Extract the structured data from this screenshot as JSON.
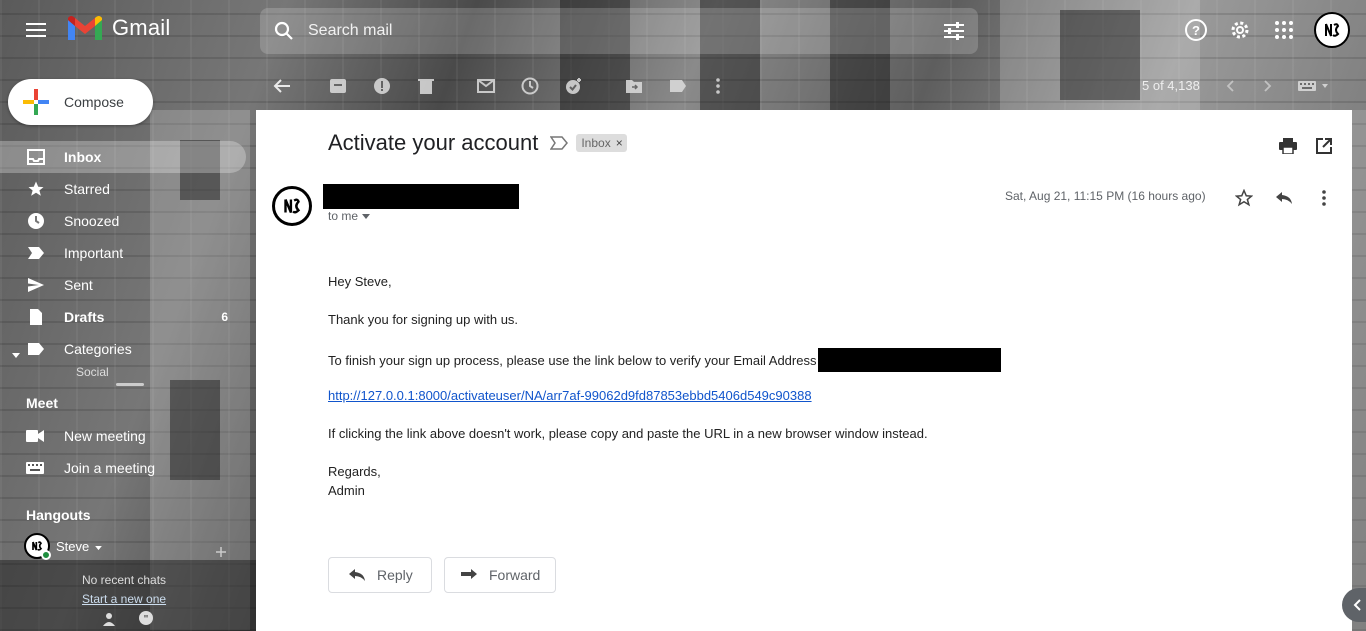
{
  "app": {
    "logo_text": "Gmail"
  },
  "search": {
    "placeholder": "Search mail"
  },
  "compose": {
    "label": "Compose"
  },
  "sidebar": {
    "items": [
      {
        "label": "Inbox",
        "icon": "inbox-icon",
        "active": true,
        "count": ""
      },
      {
        "label": "Starred",
        "icon": "star-icon",
        "count": ""
      },
      {
        "label": "Snoozed",
        "icon": "clock-icon",
        "count": ""
      },
      {
        "label": "Important",
        "icon": "important-icon",
        "count": ""
      },
      {
        "label": "Sent",
        "icon": "send-icon",
        "count": ""
      },
      {
        "label": "Drafts",
        "icon": "draft-icon",
        "count": "6"
      },
      {
        "label": "Categories",
        "icon": "label-icon",
        "count": ""
      }
    ],
    "sub_item": "Social"
  },
  "meet": {
    "title": "Meet",
    "new_meeting": "New meeting",
    "join_meeting": "Join a meeting"
  },
  "hangouts": {
    "title": "Hangouts",
    "user": "Steve",
    "no_recent": "No recent chats",
    "start_new": "Start a new one"
  },
  "toolbar": {
    "pager": "5 of 4,138"
  },
  "message": {
    "subject": "Activate your account",
    "label_chip": "Inbox",
    "label_chip_close": "×",
    "to": "to me",
    "date": "Sat, Aug 21, 11:15 PM (16 hours ago)",
    "greeting": "Hey Steve,",
    "line1": "Thank you for signing up with us.",
    "line2": "To finish your sign up process, please use the link below to verify your Email Address",
    "link": "http://127.0.0.1:8000/activateuser/NA/arr7af-99062d9fd87853ebbd5406d549c90388",
    "line3": "If clicking the link above doesn't work, please copy and paste the URL in a new browser window instead.",
    "regards": "Regards,",
    "signature": "Admin"
  },
  "actions": {
    "reply": "Reply",
    "forward": "Forward"
  },
  "colors": {
    "link": "#1155cc",
    "online": "#1e8e3e"
  }
}
